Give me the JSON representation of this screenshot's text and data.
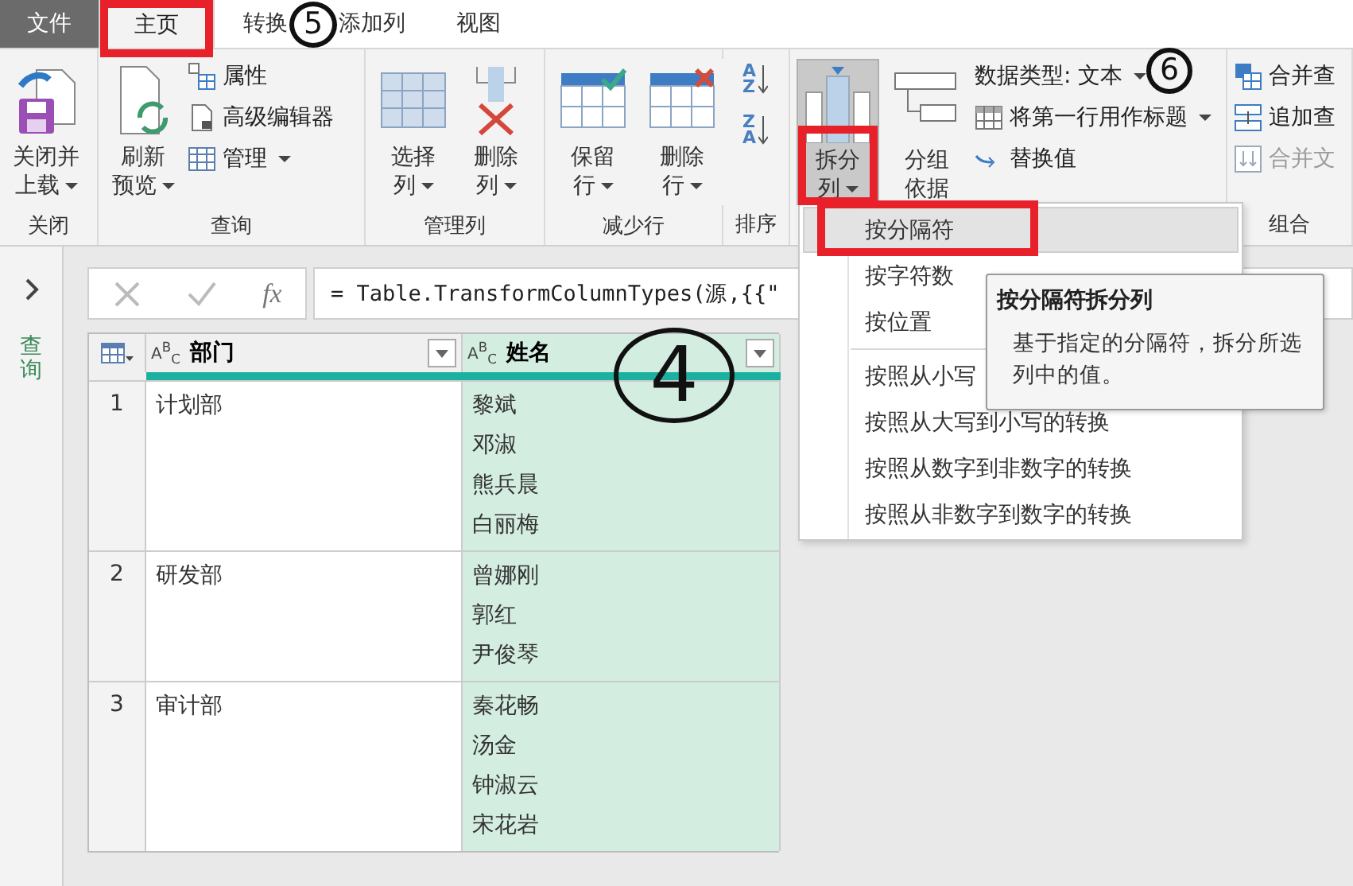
{
  "tabs": [
    {
      "label": "文件",
      "kind": "file",
      "selected": false
    },
    {
      "label": "主页",
      "kind": "tab",
      "selected": true
    },
    {
      "label": "转换",
      "kind": "tab",
      "selected": false
    },
    {
      "label": "添加列",
      "kind": "tab",
      "selected": false
    },
    {
      "label": "视图",
      "kind": "tab",
      "selected": false
    }
  ],
  "ribbon": [
    {
      "label": "关闭",
      "items": [
        {
          "kind": "large",
          "lines": [
            "关闭并",
            "上载"
          ],
          "dropdown": true,
          "pressed": false
        }
      ]
    },
    {
      "label": "查询",
      "items": [
        {
          "kind": "large",
          "lines": [
            "刷新",
            "预览"
          ],
          "dropdown": true,
          "pressed": false
        },
        {
          "kind": "stack",
          "items": [
            {
              "label": "属性",
              "dropdown": false,
              "disabled": false
            },
            {
              "label": "高级编辑器",
              "dropdown": false,
              "disabled": false
            },
            {
              "label": "管理",
              "dropdown": true,
              "disabled": false
            }
          ]
        }
      ]
    },
    {
      "label": "管理列",
      "items": [
        {
          "kind": "large",
          "lines": [
            "选择",
            "列"
          ],
          "dropdown": true,
          "pressed": false
        },
        {
          "kind": "large",
          "lines": [
            "删除",
            "列"
          ],
          "dropdown": true,
          "pressed": false
        }
      ]
    },
    {
      "label": "减少行",
      "items": [
        {
          "kind": "large",
          "lines": [
            "保留",
            "行"
          ],
          "dropdown": true,
          "pressed": false
        },
        {
          "kind": "large",
          "lines": [
            "删除",
            "行"
          ],
          "dropdown": true,
          "pressed": false
        }
      ]
    },
    {
      "label": "排序",
      "items": [
        {
          "kind": "sort",
          "letters": [
            "A",
            "Z"
          ]
        },
        {
          "kind": "sort",
          "letters": [
            "Z",
            "A"
          ]
        }
      ]
    },
    {
      "items": [
        {
          "kind": "large",
          "lines": [
            "拆分",
            "列"
          ],
          "dropdown": true,
          "pressed": true
        },
        {
          "kind": "large",
          "lines": [
            "分组",
            "依据"
          ],
          "dropdown": false,
          "pressed": false
        },
        {
          "kind": "stack",
          "items": [
            {
              "label": "数据类型: 文本",
              "dropdown": true,
              "disabled": false
            },
            {
              "label": "将第一行用作标题",
              "dropdown": true,
              "disabled": false
            },
            {
              "label": "替换值",
              "dropdown": false,
              "disabled": false
            }
          ]
        }
      ]
    },
    {
      "label": "组合",
      "items": [
        {
          "kind": "stack",
          "items": [
            {
              "label": "合并查",
              "dropdown": false,
              "disabled": false
            },
            {
              "label": "追加查",
              "dropdown": false,
              "disabled": false
            },
            {
              "label": "合并文",
              "dropdown": false,
              "disabled": true
            }
          ]
        }
      ]
    }
  ],
  "sidebar": {
    "label": "查询"
  },
  "formula_bar": {
    "fx": "fx",
    "formula": "= Table.TransformColumnTypes(源,{{\""
  },
  "table": {
    "columns": [
      {
        "type": "A$^{B}$$_{C}$",
        "name": "部门",
        "selected": false
      },
      {
        "type": "A$^{B}$$_{C}$",
        "name": "姓名",
        "selected": true
      }
    ],
    "rows": [
      {
        "index": "1",
        "dept": "计划部",
        "names": [
          "黎斌",
          "邓淑",
          "熊兵晨",
          "白丽梅"
        ]
      },
      {
        "index": "2",
        "dept": "研发部",
        "names": [
          "曾娜刚",
          "郭红",
          "尹俊琴"
        ]
      },
      {
        "index": "3",
        "dept": "审计部",
        "names": [
          "秦花畅",
          "汤金",
          "钟淑云",
          "宋花岩"
        ]
      }
    ]
  },
  "split_menu": {
    "items": [
      {
        "label": "按分隔符",
        "selected": true
      },
      {
        "label": "按字符数",
        "selected": false
      },
      {
        "label": "按位置",
        "selected": false
      },
      {
        "kind": "separator"
      },
      {
        "label": "按照从小写",
        "selected": false
      },
      {
        "label": "按照从大写到小写的转换",
        "selected": false
      },
      {
        "label": "按照从数字到非数字的转换",
        "selected": false
      },
      {
        "label": "按照从非数字到数字的转换",
        "selected": false
      }
    ]
  },
  "tooltip": {
    "title": "按分隔符拆分列",
    "body": "基于指定的分隔符，拆分所选列中的值。"
  },
  "annotations": [
    {
      "kind": "highlight"
    },
    {
      "kind": "highlight"
    },
    {
      "kind": "highlight"
    },
    {
      "kind": "circle",
      "text": "5"
    },
    {
      "kind": "circle",
      "text": "6"
    },
    {
      "kind": "circle",
      "text": "4"
    }
  ]
}
